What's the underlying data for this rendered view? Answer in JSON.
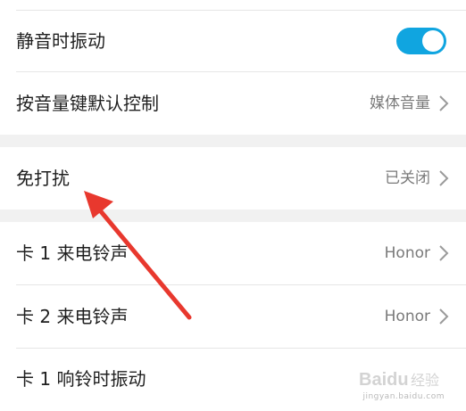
{
  "settings": {
    "vibrate_silent": {
      "label": "静音时振动",
      "enabled": true
    },
    "volume_key": {
      "label": "按音量键默认控制",
      "value": "媒体音量"
    },
    "dnd": {
      "label": "免打扰",
      "value": "已关闭"
    },
    "sim1_ringtone": {
      "label": "卡 1 来电铃声",
      "value": "Honor"
    },
    "sim2_ringtone": {
      "label": "卡 2 来电铃声",
      "value": "Honor"
    },
    "sim1_vibrate": {
      "label": "卡 1 响铃时振动"
    }
  },
  "colors": {
    "accent": "#10a5e0",
    "arrow": "#e8382e"
  },
  "watermark": {
    "text": "Baidu经验",
    "subtext": "jingyan.baidu.com"
  }
}
